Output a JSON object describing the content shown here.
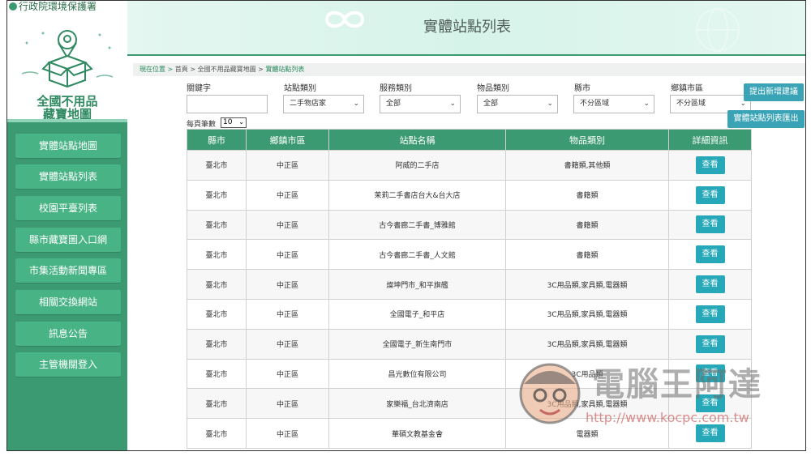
{
  "sidebar": {
    "agency": "行政院環境保護署",
    "brand_line1": "全國不用品",
    "brand_line2": "藏寶地圖",
    "items": [
      {
        "label": "實體站點地圖"
      },
      {
        "label": "實體站點列表"
      },
      {
        "label": "校園平臺列表"
      },
      {
        "label": "縣市藏寶圖入口網"
      },
      {
        "label": "市集活動新聞專區"
      },
      {
        "label": "相關交換網站"
      },
      {
        "label": "訊息公告"
      },
      {
        "label": "主管機關登入"
      }
    ]
  },
  "header": {
    "title": "實體站點列表"
  },
  "breadcrumb": {
    "prefix": "現在位置 > ",
    "home": "首頁",
    "sep1": " > ",
    "parent": "全國不用品藏寶地圖",
    "sep2": " > ",
    "current": "實體站點列表"
  },
  "filters": {
    "keyword_label": "關鍵字",
    "keyword_value": "",
    "station_type_label": "站點類別",
    "station_type_value": "二手物店家",
    "service_type_label": "服務類別",
    "service_type_value": "全部",
    "item_type_label": "物品類別",
    "item_type_value": "全部",
    "county_label": "縣市",
    "county_value": "不分區域",
    "district_label": "鄉鎮市區",
    "district_value": "不分區域"
  },
  "actions": {
    "suggest_label": "提出新增建議",
    "export_label": "實體站點列表匯出"
  },
  "perpage": {
    "label": "每頁筆數",
    "value": "10"
  },
  "table": {
    "headers": [
      "縣市",
      "鄉鎮市區",
      "站點名稱",
      "物品類別",
      "詳細資訊"
    ],
    "button_label": "查看",
    "rows": [
      [
        "臺北市",
        "中正區",
        "阿威的二手店",
        "書籍類,其他類"
      ],
      [
        "臺北市",
        "中正區",
        "茉莉二手書店台大&台大店",
        "書籍類"
      ],
      [
        "臺北市",
        "中正區",
        "古今書廊二手書_博雅館",
        "書籍類"
      ],
      [
        "臺北市",
        "中正區",
        "古今書廊二手書_人文館",
        "書籍類"
      ],
      [
        "臺北市",
        "中正區",
        "燦坤門市_和平旗艦",
        "3C用品類,家具類,電器類"
      ],
      [
        "臺北市",
        "中正區",
        "全國電子_和平店",
        "3C用品類,家具類,電器類"
      ],
      [
        "臺北市",
        "中正區",
        "全國電子_新生南門市",
        "3C用品類,家具類,電器類"
      ],
      [
        "臺北市",
        "中正區",
        "昌光數位有限公司",
        "3C用品類"
      ],
      [
        "臺北市",
        "中正區",
        "家樂福_台北濟南店",
        "3C用品類,家具類,電器類"
      ],
      [
        "臺北市",
        "中正區",
        "華碩文教基金會",
        "電器類"
      ]
    ]
  },
  "watermark": {
    "text": "電腦王阿達",
    "url": "http://www.kocpc.com.tw"
  },
  "colors": {
    "sidebar": "#3c9a72",
    "menu": "#48b384",
    "button": "#26a8b8",
    "header_row": "#3c9a72"
  }
}
